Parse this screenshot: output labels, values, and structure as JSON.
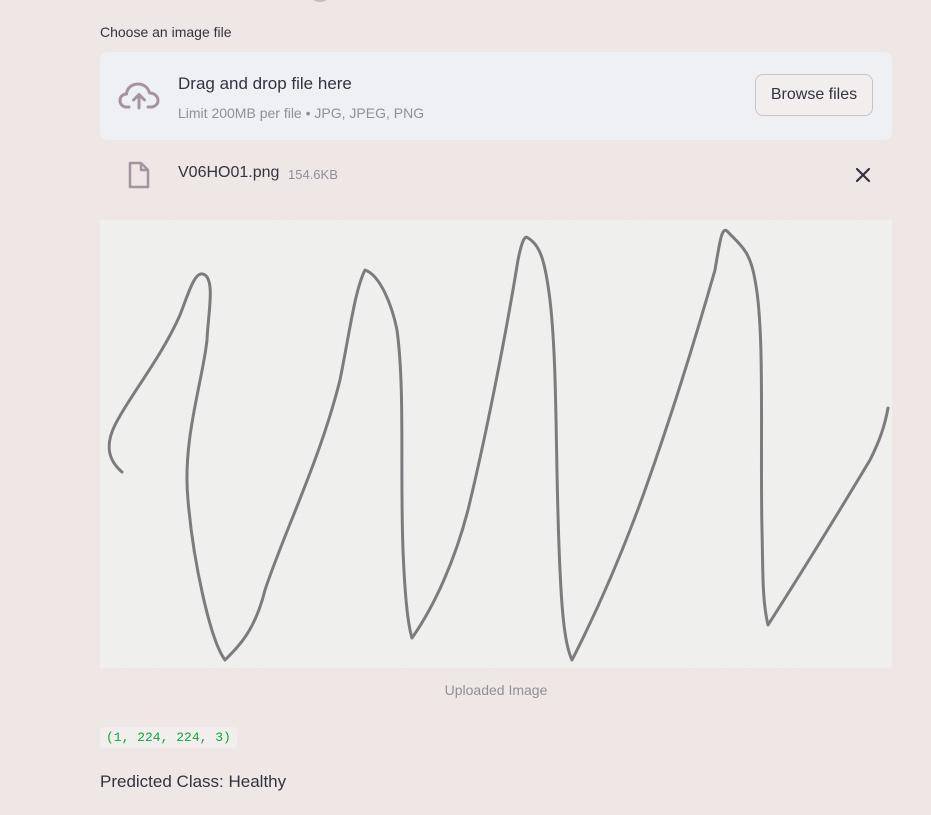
{
  "uploader": {
    "label": "Choose an image file",
    "dropzone_title": "Drag and drop file here",
    "dropzone_subtitle": "Limit 200MB per file • JPG, JPEG, PNG",
    "browse_label": "Browse files",
    "cloud_icon": "cloud-upload-icon"
  },
  "uploaded_file": {
    "name": "V06HO01.png",
    "size": "154.6KB",
    "file_icon": "file-icon",
    "remove_icon": "close-icon"
  },
  "image": {
    "caption": "Uploaded Image"
  },
  "output": {
    "shape": "(1, 224, 224, 3)",
    "prediction": "Predicted Class: Healthy"
  },
  "colors": {
    "background": "#efe7e6",
    "dropzone": "#eef0f3",
    "code_text": "#09ab3b",
    "icon": "#a4949f"
  }
}
